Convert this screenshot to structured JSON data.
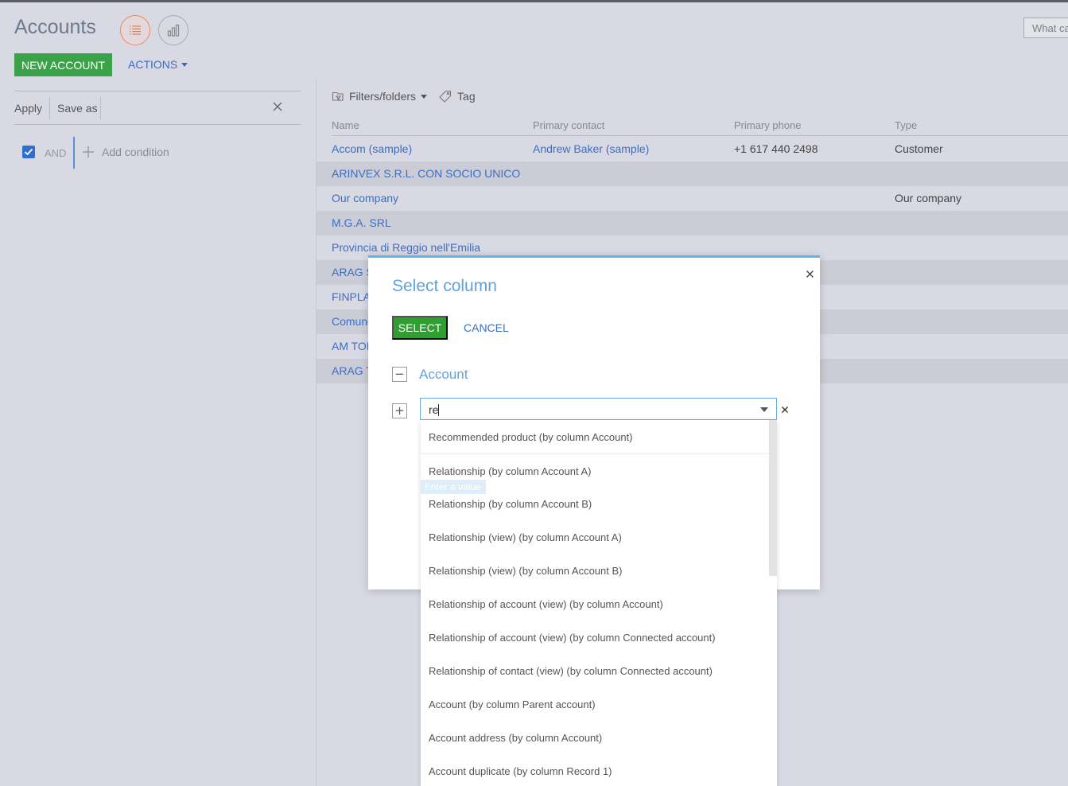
{
  "header": {
    "title": "Accounts",
    "new_account_label": "NEW ACCOUNT",
    "actions_label": "ACTIONS",
    "search_placeholder": "What ca"
  },
  "filters": {
    "apply_label": "Apply",
    "save_as_label": "Save as",
    "and_label": "AND",
    "add_condition_label": "Add condition"
  },
  "grid": {
    "toolbar": {
      "filters_folders_label": "Filters/folders",
      "tag_label": "Tag"
    },
    "columns": [
      "Name",
      "Primary contact",
      "Primary phone",
      "Type"
    ],
    "rows": [
      {
        "name": "Accom (sample)",
        "contact": "Andrew Baker (sample)",
        "phone": "+1 617 440 2498",
        "type": "Customer"
      },
      {
        "name": "ARINVEX S.R.L. CON SOCIO UNICO",
        "contact": "",
        "phone": "",
        "type": ""
      },
      {
        "name": "Our company",
        "contact": "",
        "phone": "",
        "type": "Our company"
      },
      {
        "name": "M.G.A. SRL",
        "contact": "",
        "phone": "",
        "type": ""
      },
      {
        "name": "Provincia di Reggio nell'Emilia",
        "contact": "",
        "phone": "",
        "type": ""
      },
      {
        "name": "ARAG S",
        "contact": "",
        "phone": "",
        "type": ""
      },
      {
        "name": "FINPLAS",
        "contact": "",
        "phone": "",
        "type": ""
      },
      {
        "name": "Comune",
        "contact": "",
        "phone": "",
        "type": ""
      },
      {
        "name": "AM TOR",
        "contact": "",
        "phone": "",
        "type": ""
      },
      {
        "name": "ARAG T",
        "contact": "",
        "phone": "",
        "type": ""
      }
    ]
  },
  "modal": {
    "title": "Select column",
    "select_label": "SELECT",
    "cancel_label": "CANCEL",
    "tree_root_label": "Account",
    "search_value": "re",
    "ghost_hint": "Enter a value",
    "options": [
      "Recommended product (by column Account)",
      "Relationship (by column Account A)",
      "Relationship (by column Account B)",
      "Relationship (view) (by column Account A)",
      "Relationship (view) (by column Account B)",
      "Relationship of account (view) (by column Account)",
      "Relationship of account (view) (by column Connected account)",
      "Relationship of contact (view) (by column Connected account)",
      "Account (by column Parent account)",
      "Account address (by column Account)",
      "Account duplicate (by column Record 1)"
    ]
  },
  "colors": {
    "accent_green": "#3aa34a",
    "link_blue": "#3b6ec2",
    "modal_title_blue": "#5fa3de",
    "active_view_orange": "#f0885b"
  }
}
